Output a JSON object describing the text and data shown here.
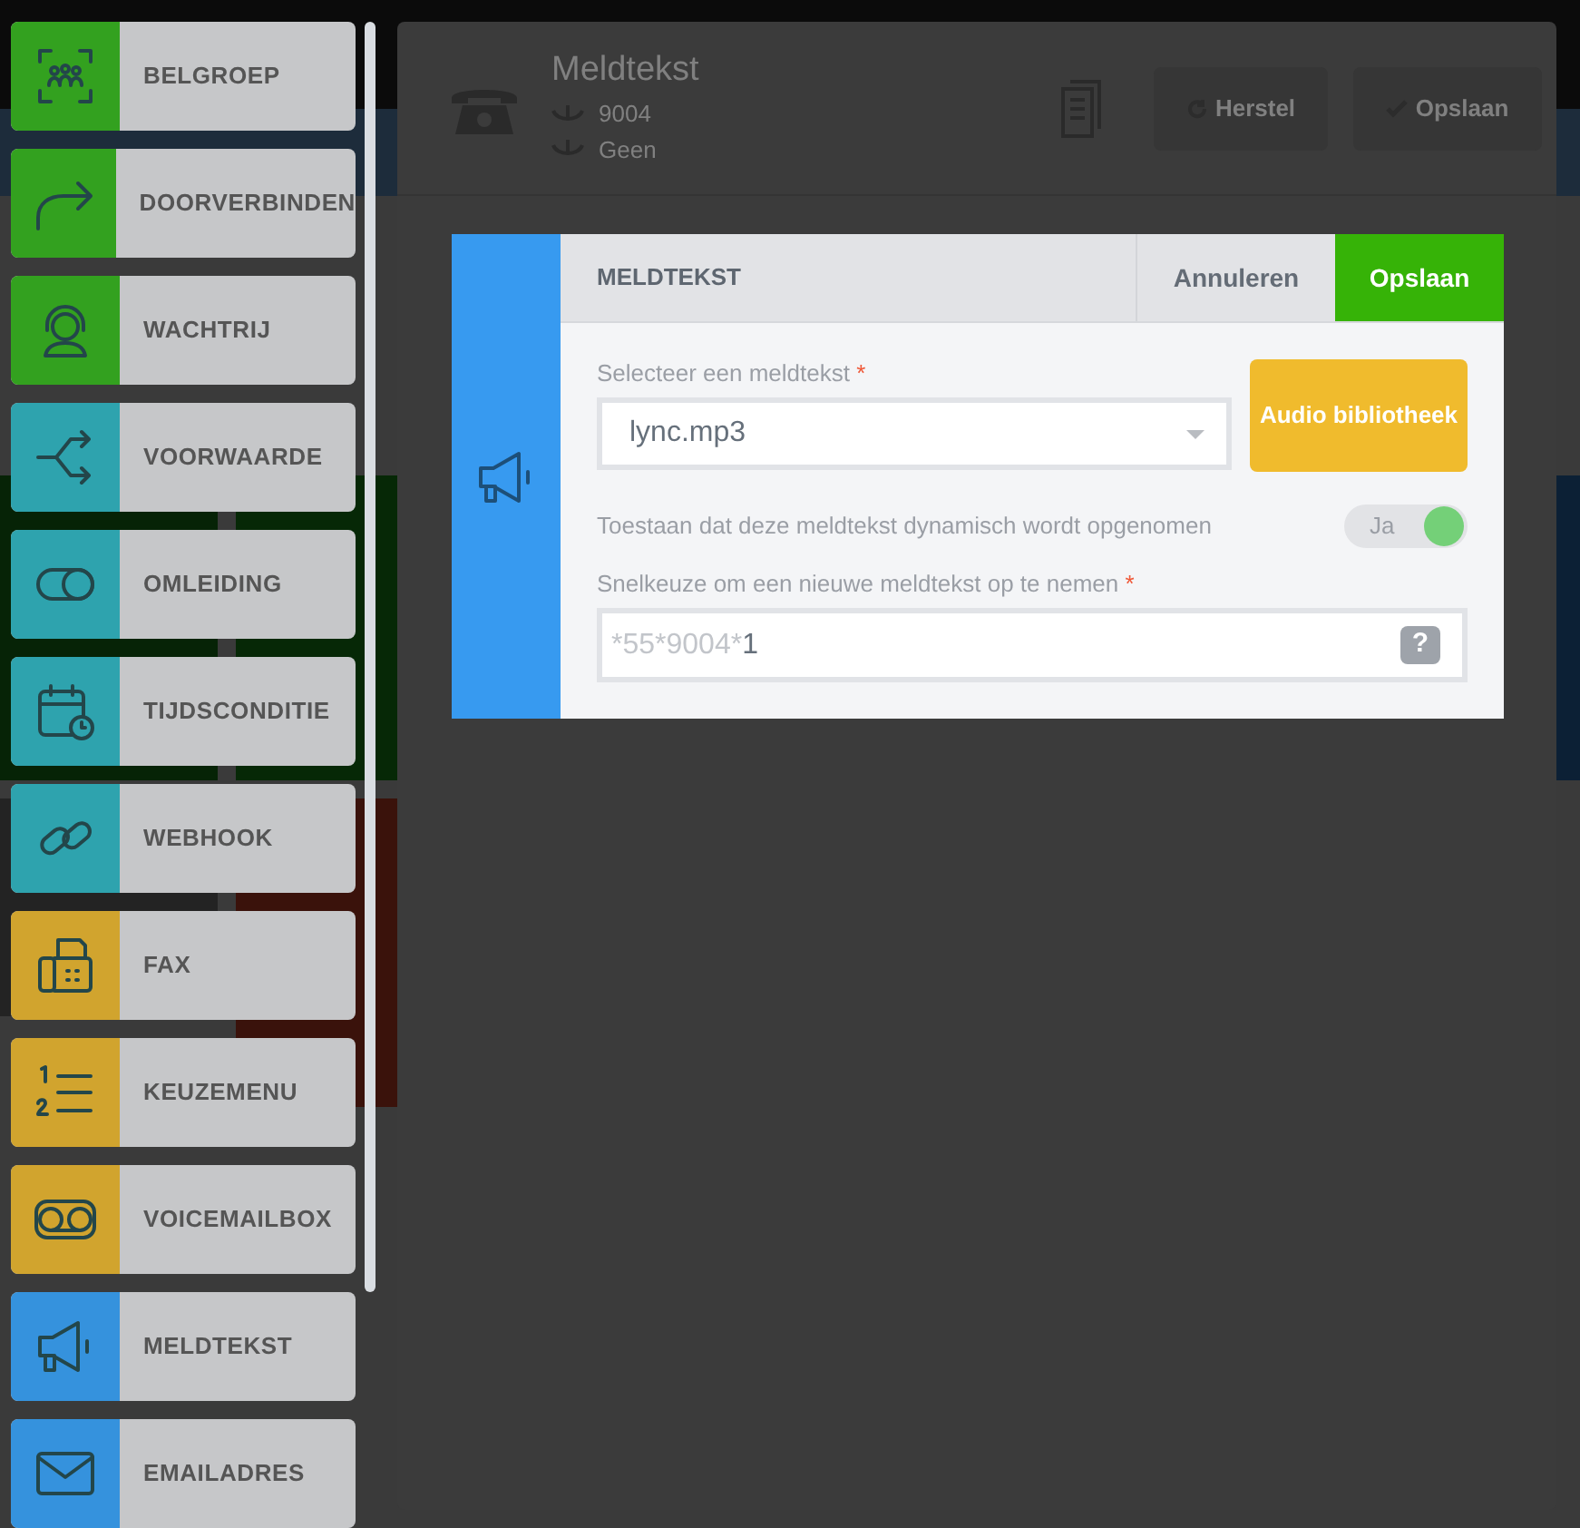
{
  "panel": {
    "title": "Meldtekst",
    "number": "9004",
    "forward": "Geen",
    "buttons": [
      "Herstel",
      "Opslaan"
    ]
  },
  "sidebar": {
    "items": [
      {
        "label": "BELGROEP",
        "color": "#33a11f"
      },
      {
        "label": "DOORVERBINDEN",
        "color": "#33a11f"
      },
      {
        "label": "WACHTRIJ",
        "color": "#33a11f"
      },
      {
        "label": "VOORWAARDE",
        "color": "#2ea3ae"
      },
      {
        "label": "OMLEIDING",
        "color": "#2ea3ae"
      },
      {
        "label": "TIJDSCONDITIE",
        "color": "#2ea3ae"
      },
      {
        "label": "WEBHOOK",
        "color": "#2ea3ae"
      },
      {
        "label": "FAX",
        "color": "#d1a42e"
      },
      {
        "label": "KEUZEMENU",
        "color": "#d1a42e"
      },
      {
        "label": "VOICEMAILBOX",
        "color": "#d1a42e"
      },
      {
        "label": "MELDTEKST",
        "color": "#3592dd"
      },
      {
        "label": "EMAILADRES",
        "color": "#3592dd"
      }
    ]
  },
  "modal": {
    "title": "MELDTEKST",
    "cancel": "Annuleren",
    "save": "Opslaan",
    "select": {
      "label": "Selecteer een meldtekst",
      "required_mark": "*",
      "value": "lync.mp3"
    },
    "library_button": "Audio bibliotheek",
    "toggle": {
      "label": "Toestaan dat deze meldtekst dynamisch wordt opgenomen",
      "text": "Ja",
      "on": true
    },
    "shortcut": {
      "label": "Snelkeuze om een nieuwe meldtekst op te nemen",
      "required_mark": "*",
      "prefix": "*55*9004*",
      "value": "1",
      "help": "?"
    }
  }
}
